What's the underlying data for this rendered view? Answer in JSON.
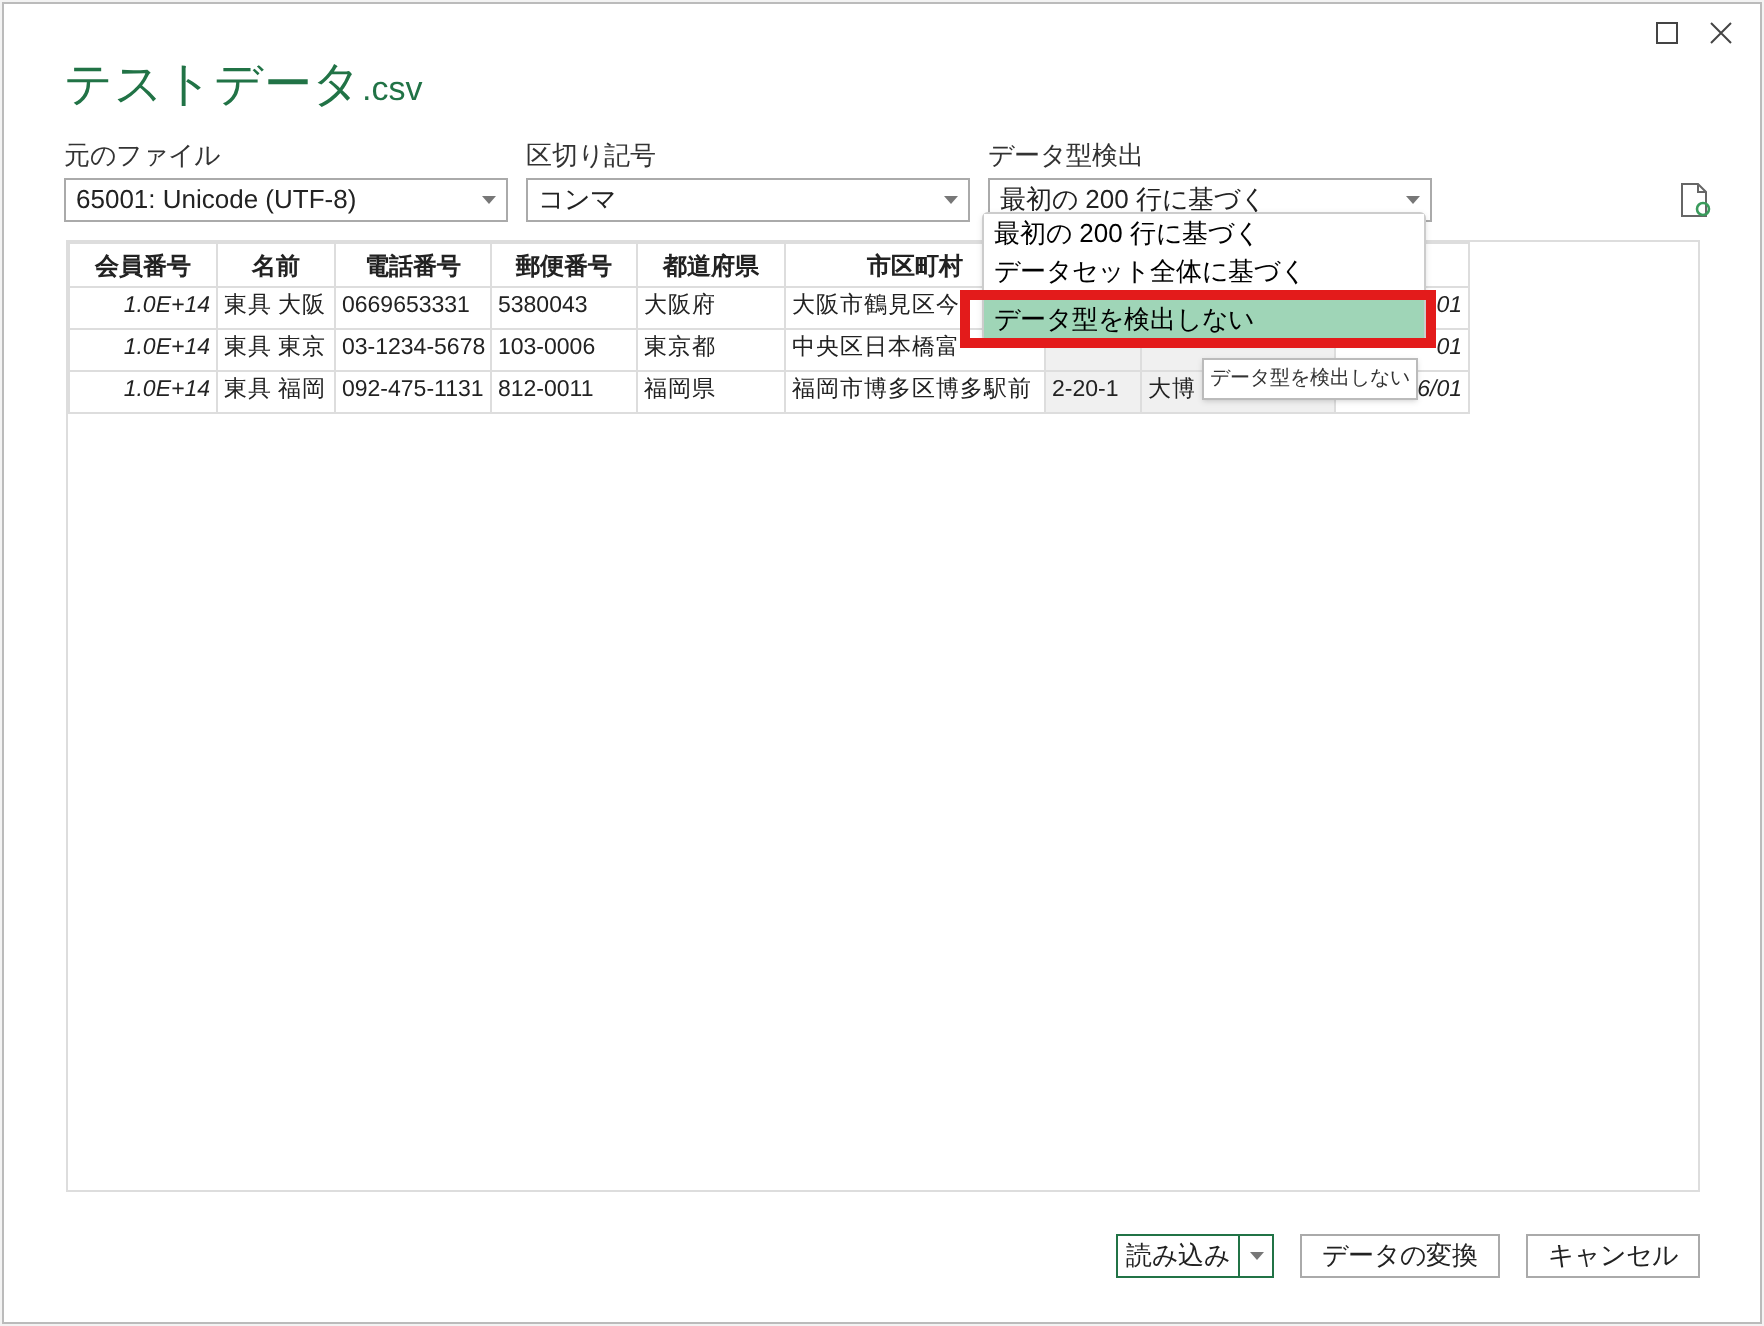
{
  "title": {
    "name": "テストデータ",
    "ext": ".csv"
  },
  "fields": [
    {
      "label": "元のファイル",
      "value": "65001: Unicode (UTF-8)"
    },
    {
      "label": "区切り記号",
      "value": "コンマ"
    },
    {
      "label": "データ型検出",
      "value": "最初の 200 行に基づく"
    }
  ],
  "dropdown": {
    "options": [
      {
        "label": "最初の 200 行に基づく",
        "selected": false,
        "highlighted": false
      },
      {
        "label": "データセット全体に基づく",
        "selected": false,
        "highlighted": false
      },
      {
        "label": "データ型を検出しない",
        "selected": true,
        "highlighted": true
      }
    ],
    "tooltip": "データ型を検出しない"
  },
  "table": {
    "columns": [
      "会員番号",
      "名前",
      "電話番号",
      "郵便番号",
      "都道府県",
      "市区町村",
      "",
      "",
      ""
    ],
    "rows": [
      [
        "1.0E+14",
        "東具 大阪",
        "0669653331",
        "5380043",
        "大阪府",
        "大阪市鶴見区今",
        "",
        "",
        "01"
      ],
      [
        "1.0E+14",
        "東具 東京",
        "03-1234-5678",
        "103-0006",
        "東京都",
        "中央区日本橋富",
        "",
        "",
        "01"
      ],
      [
        "1.0E+14",
        "東具 福岡",
        "092-475-1131",
        "812-0011",
        "福岡県",
        "福岡市博多区博多駅前",
        "2-20-1",
        "大博",
        "6/01"
      ]
    ]
  },
  "buttons": [
    {
      "label": "読み込み",
      "kind": "split"
    },
    {
      "label": "データの変換",
      "kind": "plain"
    },
    {
      "label": "キャンセル",
      "kind": "plain"
    }
  ]
}
